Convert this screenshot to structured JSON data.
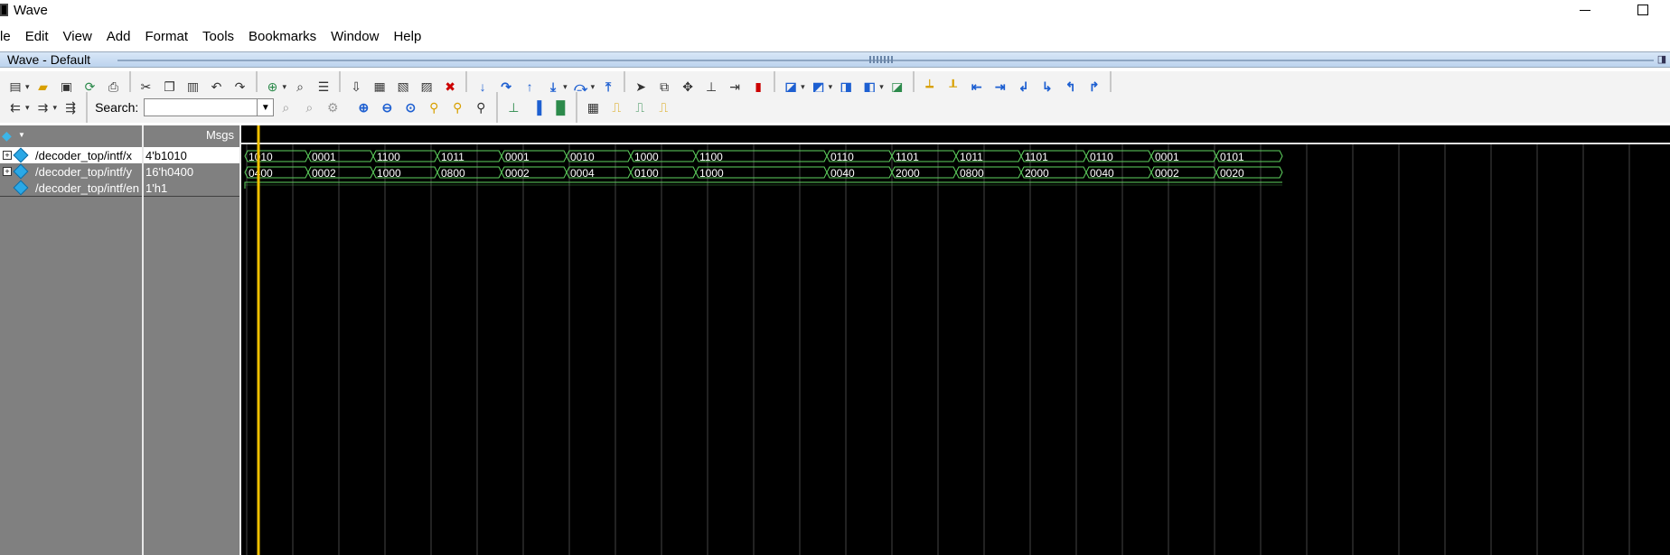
{
  "window": {
    "title": "Wave"
  },
  "menu": [
    "le",
    "Edit",
    "View",
    "Add",
    "Format",
    "Tools",
    "Bookmarks",
    "Window",
    "Help"
  ],
  "wave_header": {
    "title": "Wave - Default"
  },
  "toolbar2": {
    "search_label": "Search:",
    "search_value": ""
  },
  "panes": {
    "msgs_header": "Msgs"
  },
  "signals": [
    {
      "name": "/decoder_top/intf/x",
      "value": "4'b1010",
      "expandable": true,
      "selected": true
    },
    {
      "name": "/decoder_top/intf/y",
      "value": "16'h0400",
      "expandable": true,
      "selected": false
    },
    {
      "name": "/decoder_top/intf/en",
      "value": "1'h1",
      "expandable": false,
      "selected": false
    }
  ],
  "waveform": {
    "x_values": [
      "1010",
      "0001",
      "1100",
      "1011",
      "0001",
      "0010",
      "1000",
      "1100",
      "0110",
      "1101",
      "1011",
      "1101",
      "0110",
      "0001",
      "0101"
    ],
    "y_values": [
      "0400",
      "0002",
      "1000",
      "0800",
      "0002",
      "0004",
      "0100",
      "1000",
      "0040",
      "2000",
      "0800",
      "2000",
      "0040",
      "0002",
      "0020"
    ],
    "en_value": "1",
    "wave_color": "#5fd35f",
    "cursor_color": "#f0c000",
    "grid_color": "#444444"
  }
}
